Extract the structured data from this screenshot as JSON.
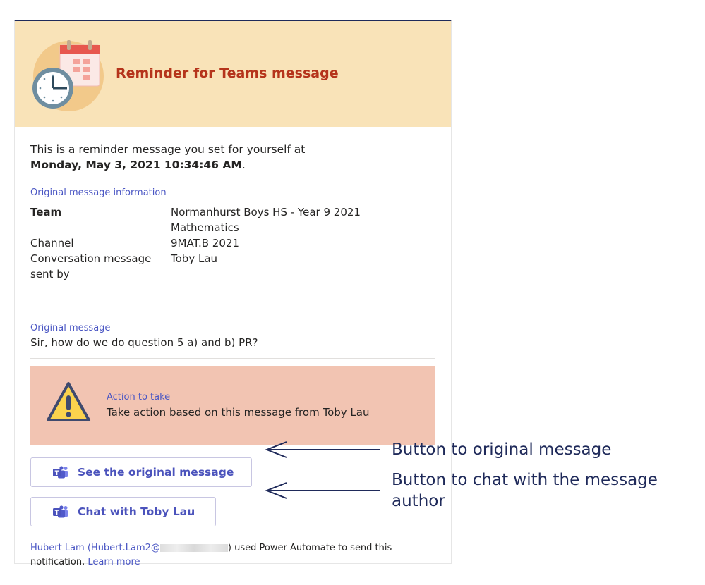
{
  "header": {
    "title": "Reminder for Teams message",
    "icon": "calendar-clock-icon",
    "background": "#f9e3b8",
    "title_color": "#b5341b"
  },
  "intro": {
    "line1": "This is a reminder message you set for yourself at",
    "datetime": "Monday, May 3, 2021 10:34:46 AM",
    "period": "."
  },
  "original_info": {
    "label": "Original message information",
    "rows": [
      {
        "key": "Team",
        "value": "Normanhurst Boys HS - Year 9 2021 Mathematics"
      },
      {
        "key": "Channel",
        "value": "9MAT.B 2021"
      },
      {
        "key": "Conversation message sent by",
        "value": "Toby Lau"
      }
    ]
  },
  "original_message": {
    "label": "Original message",
    "text": "Sir, how do we do question 5 a) and b) PR?"
  },
  "action": {
    "label": "Action to take",
    "text": "Take action based on this message from Toby Lau",
    "icon": "warning-icon",
    "background": "#f2c4b2"
  },
  "buttons": {
    "see_original": "See the original message",
    "chat_author": "Chat with Toby Lau",
    "icon": "teams-icon"
  },
  "footer": {
    "sender": "Hubert Lam (Hubert.Lam2@",
    "after_redaction": ") used Power Automate to send this notification.",
    "learn_more": "Learn more"
  },
  "annotations": {
    "to_original": "Button to original message",
    "to_chat_line1": "Button to chat with the message",
    "to_chat_line2": "author",
    "color": "#1f2a5a"
  }
}
